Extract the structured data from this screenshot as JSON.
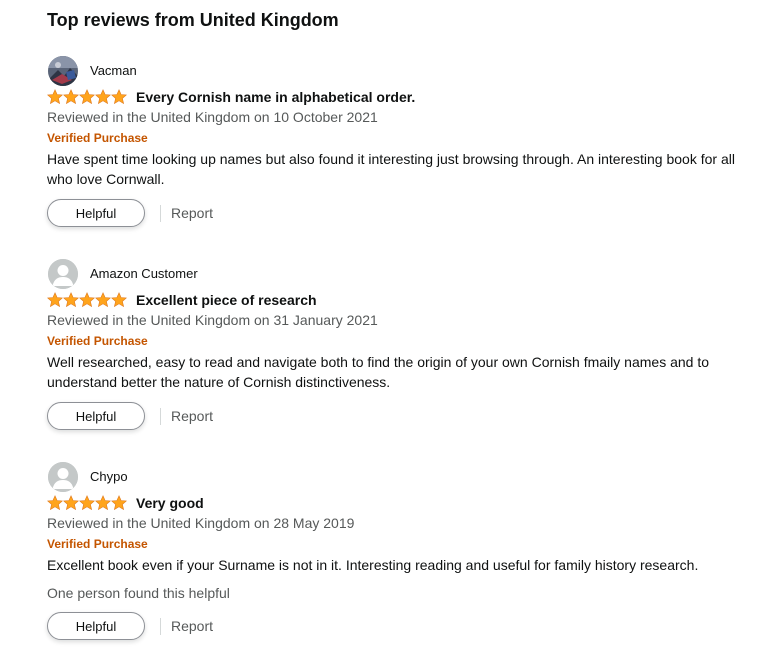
{
  "section_title": "Top reviews from United Kingdom",
  "colors": {
    "star": "#ffa41c",
    "verified": "#c45500",
    "muted": "#565959",
    "text": "#0f1111"
  },
  "reviews": [
    {
      "reviewer": "Vacman",
      "avatar": "custom-photo",
      "rating": 5,
      "title": "Every Cornish name in alphabetical order.",
      "date": "Reviewed in the United Kingdom on 10 October 2021",
      "verified": "Verified Purchase",
      "body": "Have spent time looking up names but also found it interesting just browsing through. An interesting book for all who love Cornwall.",
      "helpful_count": "",
      "helpful_label": "Helpful",
      "report_label": "Report"
    },
    {
      "reviewer": "Amazon Customer",
      "avatar": "default-user",
      "rating": 5,
      "title": "Excellent piece of research",
      "date": "Reviewed in the United Kingdom on 31 January 2021",
      "verified": "Verified Purchase",
      "body": "Well researched, easy to read and navigate both to find the origin of your own Cornish fmaily names and to understand better the nature of Cornish distinctiveness.",
      "helpful_count": "",
      "helpful_label": "Helpful",
      "report_label": "Report"
    },
    {
      "reviewer": "Chypo",
      "avatar": "default-user",
      "rating": 5,
      "title": "Very good",
      "date": "Reviewed in the United Kingdom on 28 May 2019",
      "verified": "Verified Purchase",
      "body": "Excellent book even if your Surname is not in it. Interesting reading and useful for family history research.",
      "helpful_count": "One person found this helpful",
      "helpful_label": "Helpful",
      "report_label": "Report"
    }
  ]
}
